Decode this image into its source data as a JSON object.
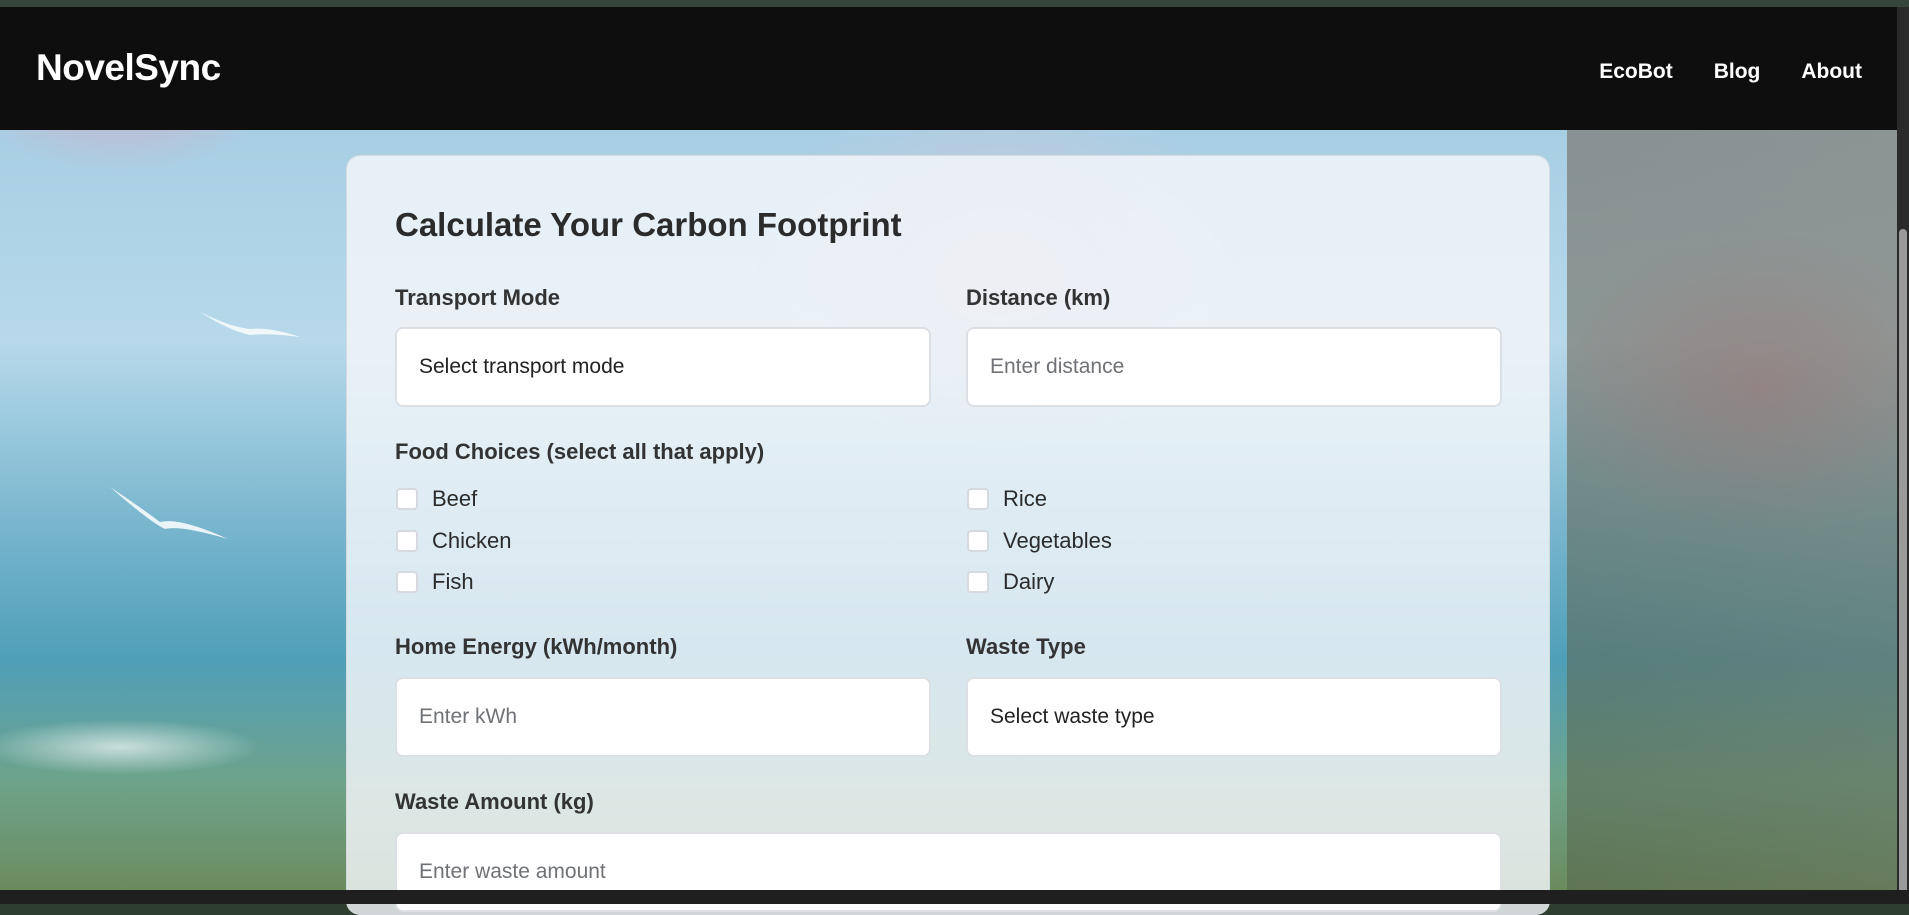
{
  "app": {
    "brand": "NovelSync"
  },
  "nav": {
    "links": [
      {
        "label": "EcoBot"
      },
      {
        "label": "Blog"
      },
      {
        "label": "About"
      }
    ]
  },
  "form": {
    "title": "Calculate Your Carbon Footprint",
    "transport": {
      "label": "Transport Mode",
      "value": "Select transport mode"
    },
    "distance": {
      "label": "Distance (km)",
      "placeholder": "Enter distance"
    },
    "food": {
      "label": "Food Choices (select all that apply)",
      "options": [
        {
          "label": "Beef",
          "checked": false
        },
        {
          "label": "Chicken",
          "checked": false
        },
        {
          "label": "Fish",
          "checked": false
        },
        {
          "label": "Rice",
          "checked": false
        },
        {
          "label": "Vegetables",
          "checked": false
        },
        {
          "label": "Dairy",
          "checked": false
        }
      ]
    },
    "energy": {
      "label": "Home Energy (kWh/month)",
      "placeholder": "Enter kWh"
    },
    "waste_type": {
      "label": "Waste Type",
      "value": "Select waste type"
    },
    "waste_amount": {
      "label": "Waste Amount (kg)",
      "placeholder": "Enter waste amount"
    }
  },
  "colors": {
    "navbar": "#0e0e0e",
    "card": "#f4f6fa",
    "text": "#2b2b2b"
  }
}
